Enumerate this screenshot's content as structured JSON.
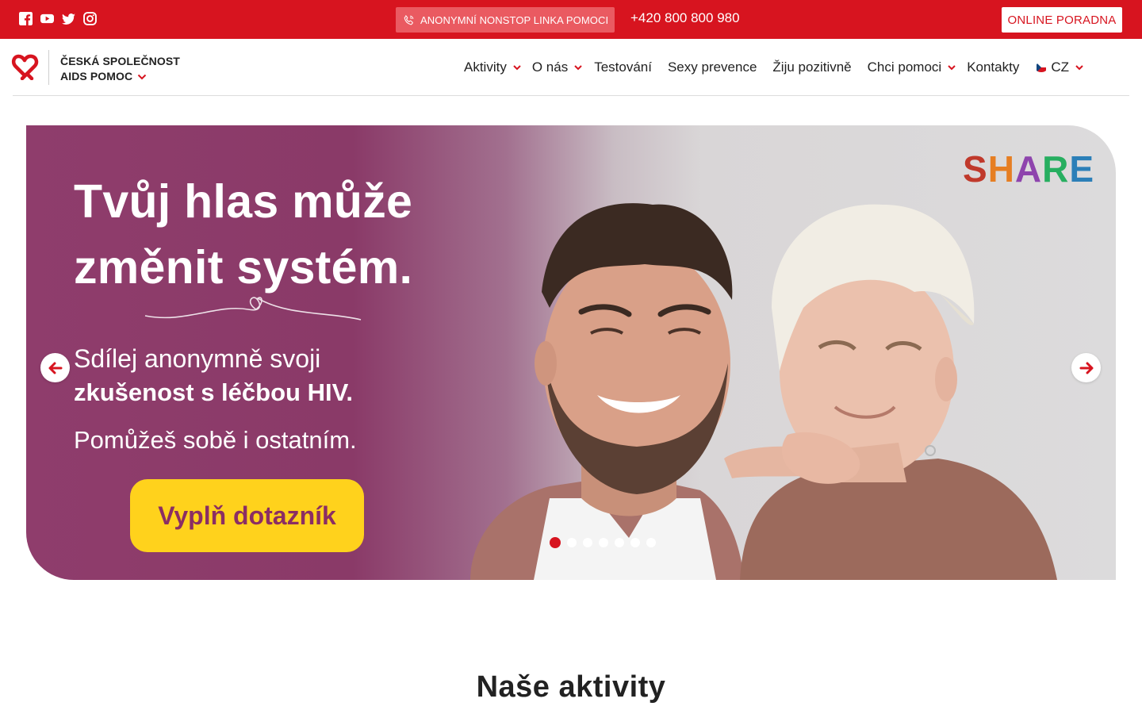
{
  "topbar": {
    "social_icons": [
      "facebook-icon",
      "youtube-icon",
      "twitter-icon",
      "instagram-icon"
    ],
    "hotline_label": "ANONYMNÍ NONSTOP LINKA POMOCI",
    "hotline_icon": "phone-icon",
    "phone": "+420 800 800 980",
    "online_button": "ONLINE PORADNA",
    "brand_color": "#d7141f"
  },
  "header": {
    "logo_line1": "ČESKÁ SPOLEČNOST",
    "logo_line2": "AIDS POMOC",
    "nav": [
      {
        "label": "Aktivity",
        "dropdown": true
      },
      {
        "label": "O nás",
        "dropdown": true
      },
      {
        "label": "Testování",
        "dropdown": false
      },
      {
        "label": "Sexy prevence",
        "dropdown": false
      },
      {
        "label": "Žiju pozitivně",
        "dropdown": false
      },
      {
        "label": "Chci pomoci",
        "dropdown": true
      },
      {
        "label": "Kontakty",
        "dropdown": false
      }
    ],
    "language": "CZ"
  },
  "hero": {
    "title_line1": "Tvůj hlas může",
    "title_line2": "změnit systém.",
    "subtitle_line1": "Sdílej anonymně svoji",
    "subtitle_line2": "zkušenost s léčbou HIV.",
    "subtitle_line3": "Pomůžeš sobě i ostatním.",
    "cta": "Vyplň dotazník",
    "badge": "SHARE",
    "slides_count": 7,
    "active_slide": 1
  },
  "sections": {
    "activities_title": "Naše aktivity"
  }
}
